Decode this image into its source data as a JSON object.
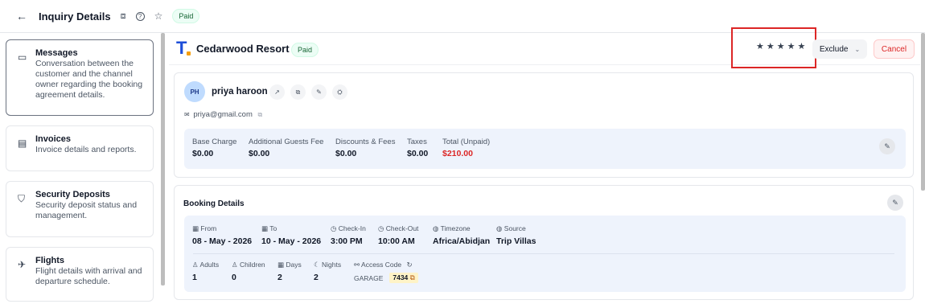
{
  "topbar": {
    "back_icon": "←",
    "title": "Inquiry Details",
    "camera_icon": "⧈",
    "help_icon": "?",
    "star_icon": "☆",
    "status": "Paid"
  },
  "sidebar": {
    "items": [
      {
        "title": "Messages",
        "desc": "Conversation between the customer and the channel owner regarding the booking agreement details.",
        "icon": "▭"
      },
      {
        "title": "Invoices",
        "desc": "Invoice details and reports.",
        "icon": "▤"
      },
      {
        "title": "Security Deposits",
        "desc": "Security deposit status and management.",
        "icon": "⛉"
      },
      {
        "title": "Flights",
        "desc": "Flight details with arrival and departure schedule.",
        "icon": "✈"
      }
    ]
  },
  "header": {
    "logo_letter": "T",
    "property": "Cedarwood Resort",
    "status": "Paid",
    "stars": "★★★★★",
    "exclude_label": "Exclude",
    "exclude_chevron": "⌄",
    "cancel_label": "Cancel"
  },
  "guest": {
    "initials": "PH",
    "name": "priya haroon",
    "email_icon": "✉",
    "email": "priya@gmail.com",
    "copy_icon": "⧉",
    "actions": [
      "↗",
      "⧉",
      "✎",
      "⛭"
    ]
  },
  "fees": {
    "items": [
      {
        "label": "Base Charge",
        "value": "$0.00"
      },
      {
        "label": "Additional Guests Fee",
        "value": "$0.00"
      },
      {
        "label": "Discounts & Fees",
        "value": "$0.00"
      },
      {
        "label": "Taxes",
        "value": "$0.00"
      },
      {
        "label": "Total (Unpaid)",
        "value": "$210.00"
      }
    ],
    "edit_icon": "✎"
  },
  "booking": {
    "title": "Booking Details",
    "edit_icon": "✎",
    "row1": [
      {
        "icon": "▦",
        "label": "From",
        "value": "08 - May - 2026"
      },
      {
        "icon": "▦",
        "label": "To",
        "value": "10 - May - 2026"
      },
      {
        "icon": "◷",
        "label": "Check-In",
        "value": "3:00 PM"
      },
      {
        "icon": "◷",
        "label": "Check-Out",
        "value": "10:00 AM"
      },
      {
        "icon": "◍",
        "label": "Timezone",
        "value": "Africa/Abidjan"
      },
      {
        "icon": "◍",
        "label": "Source",
        "value": "Trip Villas"
      }
    ],
    "row2": [
      {
        "icon": "♙",
        "label": "Adults",
        "value": "1"
      },
      {
        "icon": "♙",
        "label": "Children",
        "value": "0"
      },
      {
        "icon": "▦",
        "label": "Days",
        "value": "2"
      },
      {
        "icon": "☾",
        "label": "Nights",
        "value": "2"
      }
    ],
    "access": {
      "icon": "⚯",
      "label": "Access Code",
      "refresh_icon": "↻",
      "name": "GARAGE",
      "code": "7434",
      "copy_icon": "⧉"
    }
  }
}
